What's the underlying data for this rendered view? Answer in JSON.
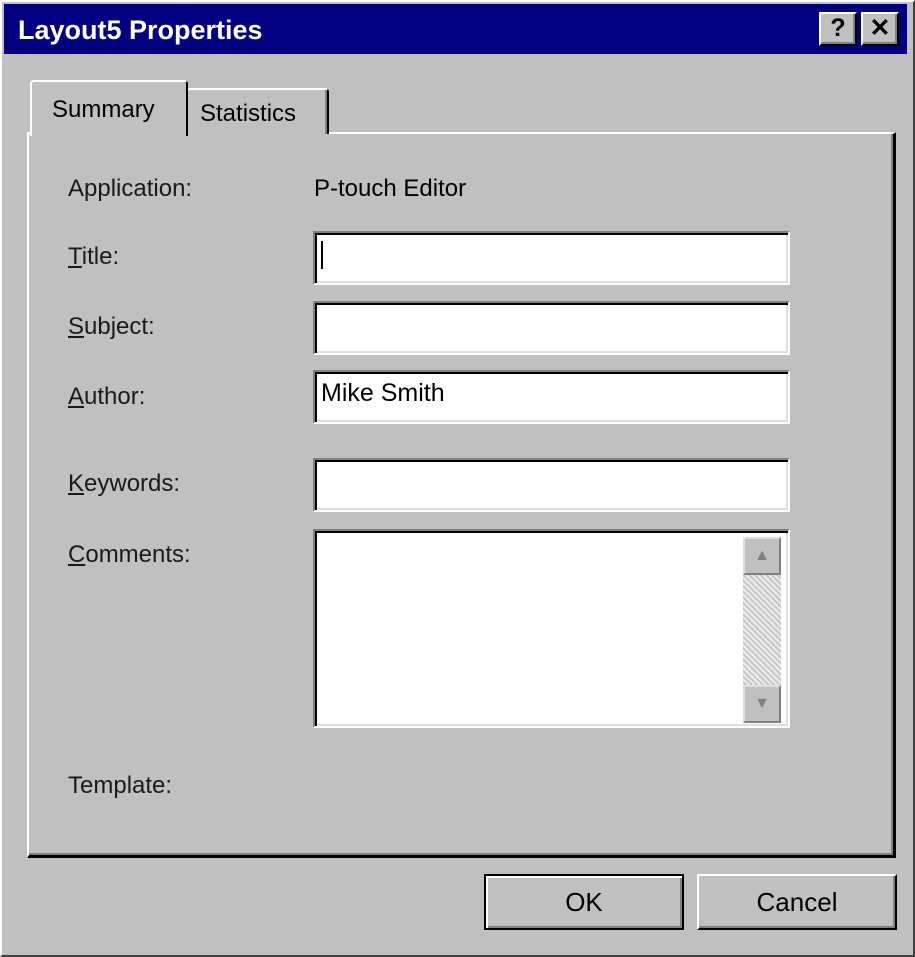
{
  "window": {
    "title": "Layout5 Properties",
    "help_glyph": "?",
    "close_glyph": "✕"
  },
  "tabs": [
    {
      "label": "Summary",
      "active": true
    },
    {
      "label": "Statistics",
      "active": false
    }
  ],
  "summary": {
    "application_label": "Application:",
    "application_value": "P-touch Editor",
    "title_label": {
      "mnemonic": "T",
      "rest": "itle:"
    },
    "title_value": "",
    "subject_label": {
      "mnemonic": "S",
      "rest": "ubject:"
    },
    "subject_value": "",
    "author_label": {
      "mnemonic": "A",
      "rest": "uthor:"
    },
    "author_value": "Mike Smith",
    "keywords_label": {
      "mnemonic": "K",
      "rest": "eywords:"
    },
    "keywords_value": "",
    "comments_label": {
      "mnemonic": "C",
      "rest": "omments:"
    },
    "comments_value": "",
    "template_label": "Template:"
  },
  "scrollbar": {
    "up_glyph": "▲",
    "down_glyph": "▼"
  },
  "buttons": {
    "ok": "OK",
    "cancel": "Cancel"
  },
  "colors": {
    "titlebar": "#000080",
    "face": "#c0c0c0"
  }
}
